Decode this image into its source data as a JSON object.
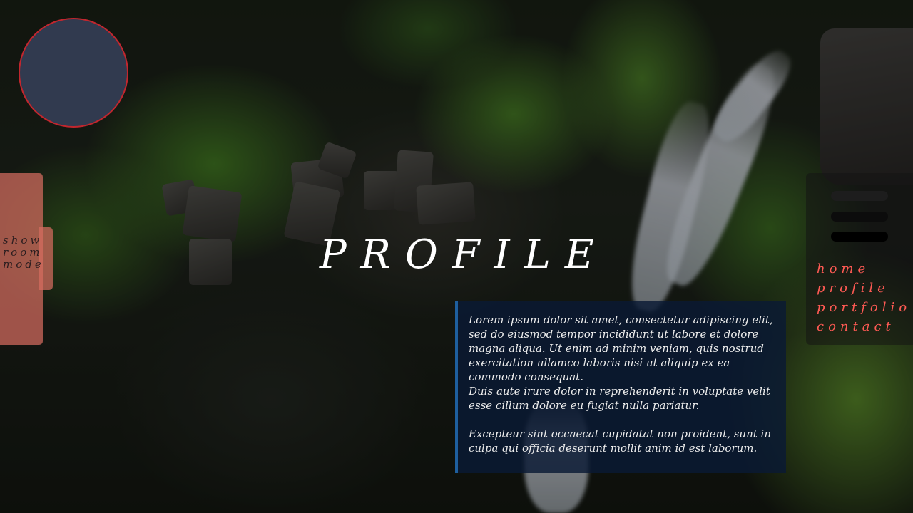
{
  "sidebar": {
    "mode_lines": [
      "show",
      "room",
      "mode"
    ]
  },
  "main": {
    "title": "PROFILE",
    "paragraphs": [
      "Lorem ipsum dolor sit amet, consectetur adipiscing elit, sed do eiusmod tempor incididunt ut labore et dolore magna aliqua. Ut enim ad minim veniam, quis nostrud exercitation ullamco laboris nisi ut aliquip ex ea commodo consequat.",
      "Duis aute irure dolor in reprehenderit in voluptate velit esse cillum dolore eu fugiat nulla pariatur.",
      "Excepteur sint occaecat cupidatat non proident, sunt in culpa qui officia deserunt mollit anim id est laborum."
    ]
  },
  "nav": {
    "menu_icon": "hamburger-menu-icon",
    "items": [
      "home",
      "profile",
      "portfolio",
      "contact"
    ]
  },
  "colors": {
    "logo_fill": "#313a4f",
    "logo_ring": "#c2262e",
    "mode_tab": "#d66c60",
    "nav_link": "#ff5a54",
    "card_accent": "#1e5f9e",
    "card_bg": "#0a1a34"
  }
}
